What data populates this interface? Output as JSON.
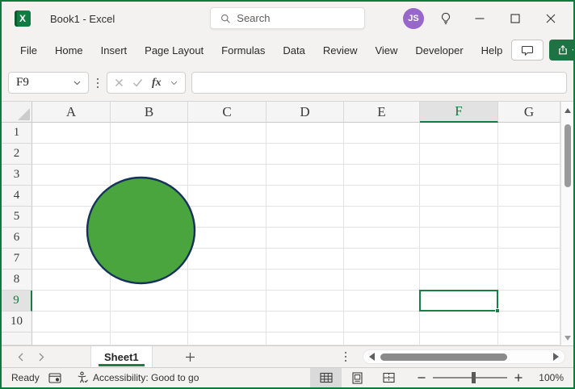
{
  "window": {
    "title": "Book1  -  Excel"
  },
  "titlebar": {
    "search_placeholder": "Search",
    "user_initials": "JS"
  },
  "menu": {
    "items": [
      "File",
      "Home",
      "Insert",
      "Page Layout",
      "Formulas",
      "Data",
      "Review",
      "View",
      "Developer",
      "Help"
    ]
  },
  "formula_bar": {
    "cell_reference": "F9",
    "fx_label": "fx",
    "formula_value": ""
  },
  "grid": {
    "column_headers": [
      "A",
      "B",
      "C",
      "D",
      "E",
      "F",
      "G"
    ],
    "row_headers": [
      "1",
      "2",
      "3",
      "4",
      "5",
      "6",
      "7",
      "8",
      "9",
      "10"
    ],
    "selected_cell": "F9",
    "selected_column": "F",
    "selected_row": "9",
    "shape": {
      "type": "oval",
      "fill": "#4aa53f",
      "stroke": "#16325c"
    }
  },
  "sheet_tabs": {
    "active_tab": "Sheet1"
  },
  "status_bar": {
    "mode": "Ready",
    "accessibility_status": "Accessibility: Good to go",
    "zoom_level": "100%"
  },
  "icons": {
    "search-icon": "magnifier",
    "idea-icon": "lightbulb",
    "minimize-icon": "horizontal-line",
    "maximize-icon": "square-outline",
    "close-icon": "x-cross",
    "comments-icon": "speech-bubble",
    "share-icon": "arrow-out-of-box",
    "macro-record-icon": "sheet-with-dot",
    "accessibility-icon": "person-with-check",
    "normal-view-icon": "grid-table",
    "page-layout-icon": "page-with-margins",
    "page-break-icon": "split-page"
  },
  "colors": {
    "accent_green": "#107c41",
    "share_button_green": "#1f7244",
    "avatar_purple": "#9768c9",
    "selection_border": "#1a7e45"
  }
}
